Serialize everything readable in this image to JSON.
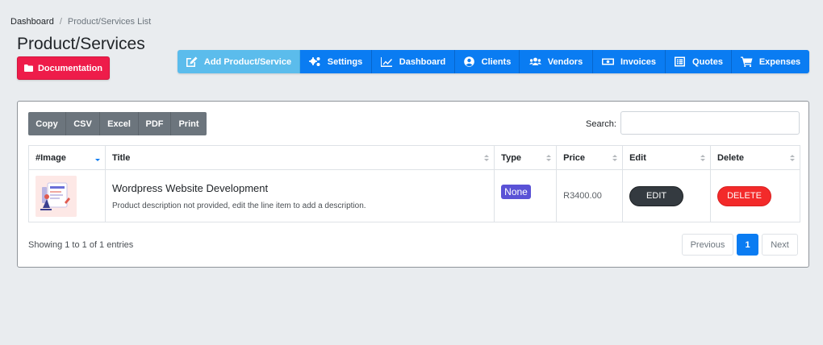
{
  "breadcrumb": {
    "home": "Dashboard",
    "separator": "/",
    "current": "Product/Services List"
  },
  "page_title": "Product/Services",
  "documentation_label": "Documentation",
  "toolbar": [
    {
      "label": "Add Product/Service",
      "icon": "edit-icon"
    },
    {
      "label": "Settings",
      "icon": "gears-icon"
    },
    {
      "label": "Dashboard",
      "icon": "chart-line-icon"
    },
    {
      "label": "Clients",
      "icon": "user-circle-icon"
    },
    {
      "label": "Vendors",
      "icon": "users-icon"
    },
    {
      "label": "Invoices",
      "icon": "money-bill-icon"
    },
    {
      "label": "Quotes",
      "icon": "list-alt-icon"
    },
    {
      "label": "Expenses",
      "icon": "shopping-cart-icon"
    }
  ],
  "export_buttons": [
    "Copy",
    "CSV",
    "Excel",
    "PDF",
    "Print"
  ],
  "search": {
    "label": "Search:",
    "value": "",
    "placeholder": ""
  },
  "table": {
    "columns": [
      "#Image",
      "Title",
      "Type",
      "Price",
      "Edit",
      "Delete"
    ],
    "rows": [
      {
        "title": "Wordpress Website Development",
        "description": "Product description not provided, edit the line item to add a description.",
        "type": "None",
        "price": "R3400.00",
        "edit_label": "EDIT",
        "delete_label": "DELETE"
      }
    ]
  },
  "info_text": "Showing 1 to 1 of 1 entries",
  "pagination": {
    "previous": "Previous",
    "current": "1",
    "next": "Next"
  },
  "colors": {
    "primary": "#0a7cf2",
    "active_tab": "#5bbcec",
    "documentation": "#ee1c4a",
    "badge": "#5a52d6",
    "delete": "#f32a2a",
    "edit": "#343a40",
    "export": "#6c757d"
  }
}
